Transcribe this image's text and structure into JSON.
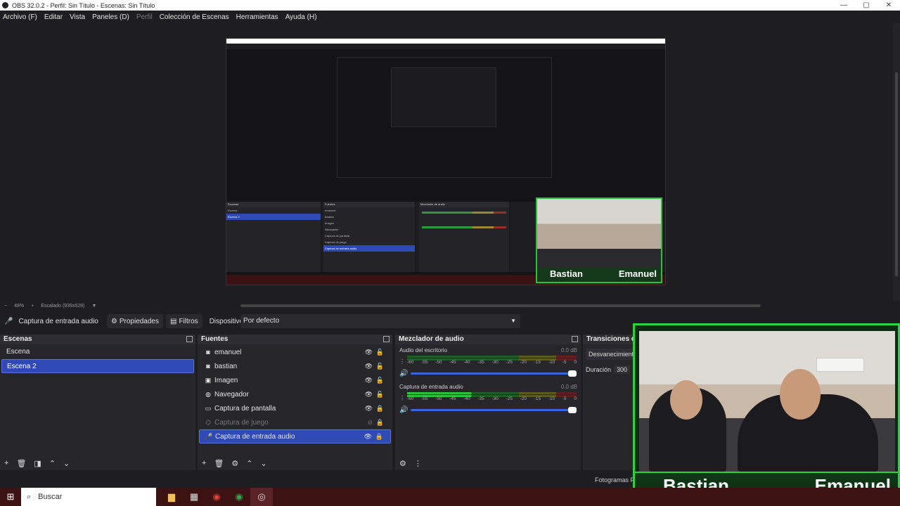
{
  "window": {
    "title": "OBS 32.0.2 - Perfil: Sin Título - Escenas: Sin Título",
    "controls": [
      "—",
      "▢",
      "✕"
    ]
  },
  "menu": {
    "items": [
      {
        "label": "Archivo (F)",
        "enabled": true
      },
      {
        "label": "Editar",
        "enabled": true
      },
      {
        "label": "Vista",
        "enabled": true
      },
      {
        "label": "Paneles (D)",
        "enabled": true
      },
      {
        "label": "Perfil",
        "enabled": false
      },
      {
        "label": "Colección de Escenas",
        "enabled": true
      },
      {
        "label": "Herramientas",
        "enabled": true
      },
      {
        "label": "Ayuda (H)",
        "enabled": true
      }
    ]
  },
  "preview": {
    "zoom": "48%",
    "scaling": "Escalado (939x528)",
    "embedded_names": [
      "Bastian",
      "Emanuel"
    ]
  },
  "properties_bar": {
    "source_label": "Captura de entrada audio",
    "properties_button": "Propiedades",
    "filters_button": "Filtros",
    "device_label": "Dispositivo",
    "device_value": "Por defecto"
  },
  "scenes": {
    "title": "Escenas",
    "items": [
      {
        "label": "Escena",
        "selected": false
      },
      {
        "label": "Escena 2",
        "selected": true
      }
    ]
  },
  "sources": {
    "title": "Fuentes",
    "items": [
      {
        "label": "emanuel",
        "icon": "camera-icon",
        "visible": true,
        "locked": false,
        "selected": false
      },
      {
        "label": "bastian",
        "icon": "camera-icon",
        "visible": true,
        "locked": false,
        "selected": false
      },
      {
        "label": "Imagen",
        "icon": "image-icon",
        "visible": true,
        "locked": false,
        "selected": false
      },
      {
        "label": "Navegador",
        "icon": "globe-icon",
        "visible": true,
        "locked": false,
        "selected": false
      },
      {
        "label": "Captura de pantalla",
        "icon": "monitor-icon",
        "visible": true,
        "locked": true,
        "selected": false
      },
      {
        "label": "Captura de juego",
        "icon": "gamepad-icon",
        "visible": false,
        "locked": true,
        "selected": false
      },
      {
        "label": "Captura de entrada audio",
        "icon": "microphone-icon",
        "visible": true,
        "locked": true,
        "selected": true
      }
    ]
  },
  "mixer": {
    "title": "Mezclador de audio",
    "scale": [
      "-60",
      "-55",
      "-50",
      "-45",
      "-40",
      "-35",
      "-30",
      "-25",
      "-20",
      "-15",
      "-10",
      "-5",
      "0"
    ],
    "channels": [
      {
        "name": "Audio del escritorio",
        "db": "0.0 dB",
        "volume": 1.0
      },
      {
        "name": "Captura de entrada audio",
        "db": "0.0 dB",
        "volume": 1.0
      }
    ]
  },
  "transitions": {
    "title": "Transiciones de",
    "selected": "Desvanecimiento",
    "duration_label": "Duración",
    "duration_value": "300"
  },
  "status": {
    "fps_label": "Fotogramas P"
  },
  "webcam": {
    "names": [
      "Bastian",
      "Emanuel"
    ],
    "border_color": "#29d43e"
  },
  "taskbar": {
    "search_placeholder": "Buscar",
    "apps": [
      "folder-icon",
      "store-icon",
      "chrome-icon",
      "chrome-icon-2",
      "obs-icon"
    ]
  },
  "colors": {
    "accent": "#2f4ab6",
    "background": "#1e1e22",
    "meter_green": "#27c43a",
    "taskbar": "#3c1212"
  }
}
